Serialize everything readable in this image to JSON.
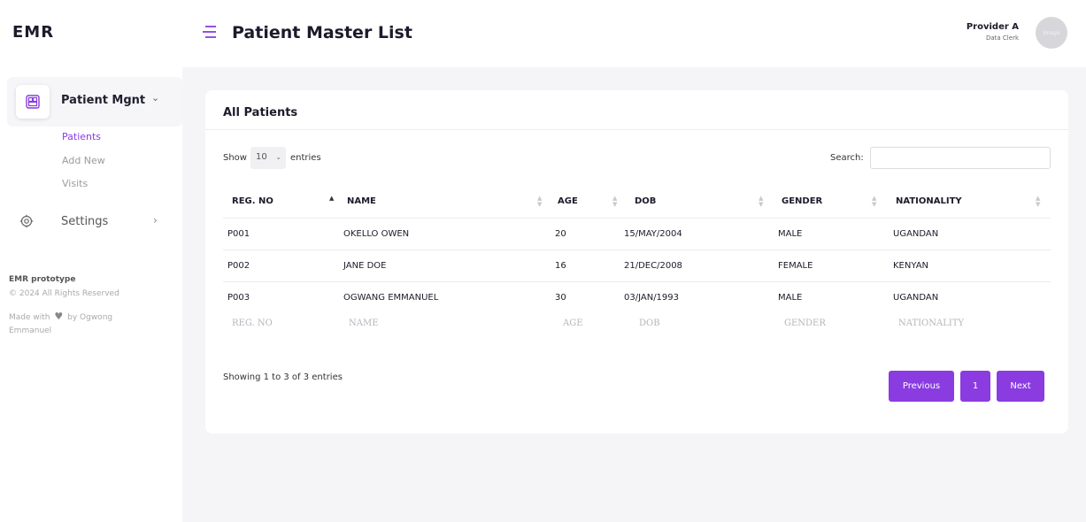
{
  "brand": "EMR",
  "sidebar": {
    "group_label": "Patient Mgnt",
    "items": [
      {
        "label": "Patients",
        "active": true
      },
      {
        "label": "Add New",
        "active": false
      },
      {
        "label": "Visits",
        "active": false
      }
    ],
    "settings_label": "Settings",
    "footer_title": "EMR prototype",
    "footer_copy": "© 2024 All Rights Reserved",
    "footer_made_prefix": "Made with",
    "footer_made_suffix": "by Ogwong Emmanuel"
  },
  "header": {
    "title": "Patient Master List",
    "user_name": "Provider A",
    "user_role": "Data Clerk",
    "avatar_text": "Image"
  },
  "card": {
    "title": "All Patients",
    "show_label": "Show",
    "show_value": "10",
    "entries_label": "entries",
    "search_label": "Search:",
    "search_value": "",
    "columns": [
      "REG. NO",
      "NAME",
      "AGE",
      "DOB",
      "GENDER",
      "NATIONALITY"
    ],
    "rows": [
      [
        "P001",
        "OKELLO OWEN",
        "20",
        "15/MAY/2004",
        "MALE",
        "UGANDAN"
      ],
      [
        "P002",
        "JANE DOE",
        "16",
        "21/DEC/2008",
        "FEMALE",
        "KENYAN"
      ],
      [
        "P003",
        "OGWANG EMMANUEL",
        "30",
        "03/JAN/1993",
        "MALE",
        "UGANDAN"
      ]
    ],
    "footer_columns": [
      "REG. NO",
      "NAME",
      "AGE",
      "DOB",
      "GENDER",
      "NATIONALITY"
    ],
    "showing_text": "Showing 1 to 3 of 3 entries",
    "pagination": {
      "previous": "Previous",
      "current": "1",
      "next": "Next"
    }
  },
  "colors": {
    "accent": "#8a3ce0",
    "background": "#f5f5f7"
  }
}
